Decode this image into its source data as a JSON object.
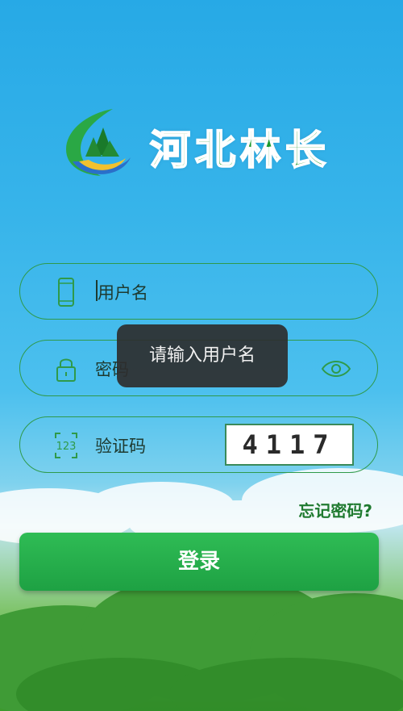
{
  "app": {
    "brand_title": "河北林长"
  },
  "login_form": {
    "username_placeholder": "用户名",
    "password_placeholder": "密码",
    "captcha_label": "验证码",
    "captcha_value": "4117",
    "forgot_password": "忘记密码?",
    "login_button": "登录"
  },
  "toast": {
    "message": "请输入用户名"
  },
  "icons": {
    "username": "phone-icon",
    "password": "lock-icon",
    "captcha": "number-123-icon",
    "show_password": "eye-icon"
  },
  "colors": {
    "accent": "#1ea143",
    "field_border": "#2f9a4a",
    "forgot_link": "#1f7a2f",
    "sky": "#37b4ea"
  }
}
